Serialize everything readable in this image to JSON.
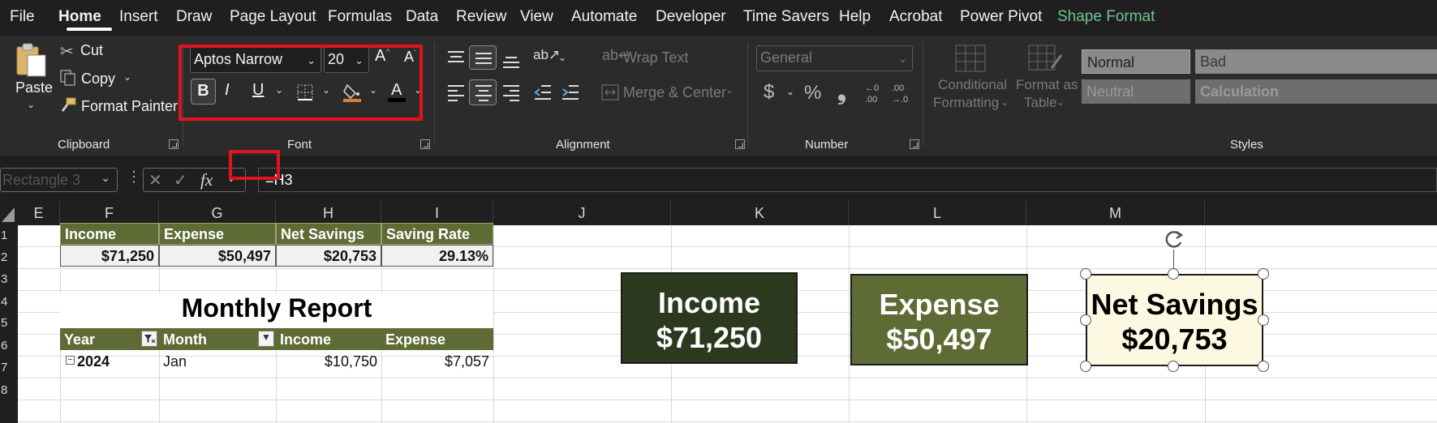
{
  "menu": {
    "tabs": [
      "File",
      "Home",
      "Insert",
      "Draw",
      "Page Layout",
      "Formulas",
      "Data",
      "Review",
      "View",
      "Automate",
      "Developer",
      "Time Savers",
      "Help",
      "Acrobat",
      "Power Pivot",
      "Shape Format"
    ],
    "active": "Home"
  },
  "ribbon": {
    "clipboard": {
      "paste": "Paste",
      "cut": "Cut",
      "copy": "Copy",
      "format_painter": "Format Painter",
      "title": "Clipboard"
    },
    "font": {
      "name": "Aptos Narrow",
      "size": "20",
      "bold": "B",
      "italic": "I",
      "underline": "U",
      "title": "Font"
    },
    "alignment": {
      "wrap_text": "Wrap Text",
      "merge_center": "Merge & Center",
      "title": "Alignment"
    },
    "number": {
      "format": "General",
      "currency": "$",
      "percent": "%",
      "comma": "❟",
      "title": "Number"
    },
    "styles": {
      "conditional_line1": "Conditional",
      "conditional_line2": "Formatting",
      "table_line1": "Format as",
      "table_line2": "Table",
      "normal": "Normal",
      "bad": "Bad",
      "neutral": "Neutral",
      "calculation": "Calculation",
      "title": "Styles"
    }
  },
  "formula_bar": {
    "name_box": "Rectangle 3",
    "fx": "fx",
    "formula": "=H3"
  },
  "sheet": {
    "columns": [
      "E",
      "F",
      "G",
      "H",
      "I",
      "J",
      "K",
      "L",
      "M"
    ],
    "rows": [
      "1",
      "2",
      "3",
      "4",
      "5",
      "6",
      "7",
      "8"
    ],
    "summary_headers": [
      "Income",
      "Expense",
      "Net Savings",
      "Saving Rate"
    ],
    "summary_values": [
      "$71,250",
      "$50,497",
      "$20,753",
      "29.13%"
    ],
    "report_title": "Monthly Report",
    "table_headers": [
      "Year",
      "Month",
      "Income",
      "Expense"
    ],
    "table_row": {
      "year": "2024",
      "month": "Jan",
      "income": "$10,750",
      "expense": "$7,057"
    }
  },
  "shapes": {
    "income": {
      "label": "Income",
      "value": "$71,250",
      "fill": "#2b3a1f"
    },
    "expense": {
      "label": "Expense",
      "value": "$50,497",
      "fill": "#5e6b34"
    },
    "net_savings": {
      "label": "Net Savings",
      "value": "$20,753",
      "fill": "#fdf8e1"
    }
  },
  "colors": {
    "accent_green": "#5e6b34",
    "highlight_red": "#e0141e",
    "shape_format_tab": "#6fc58f"
  }
}
